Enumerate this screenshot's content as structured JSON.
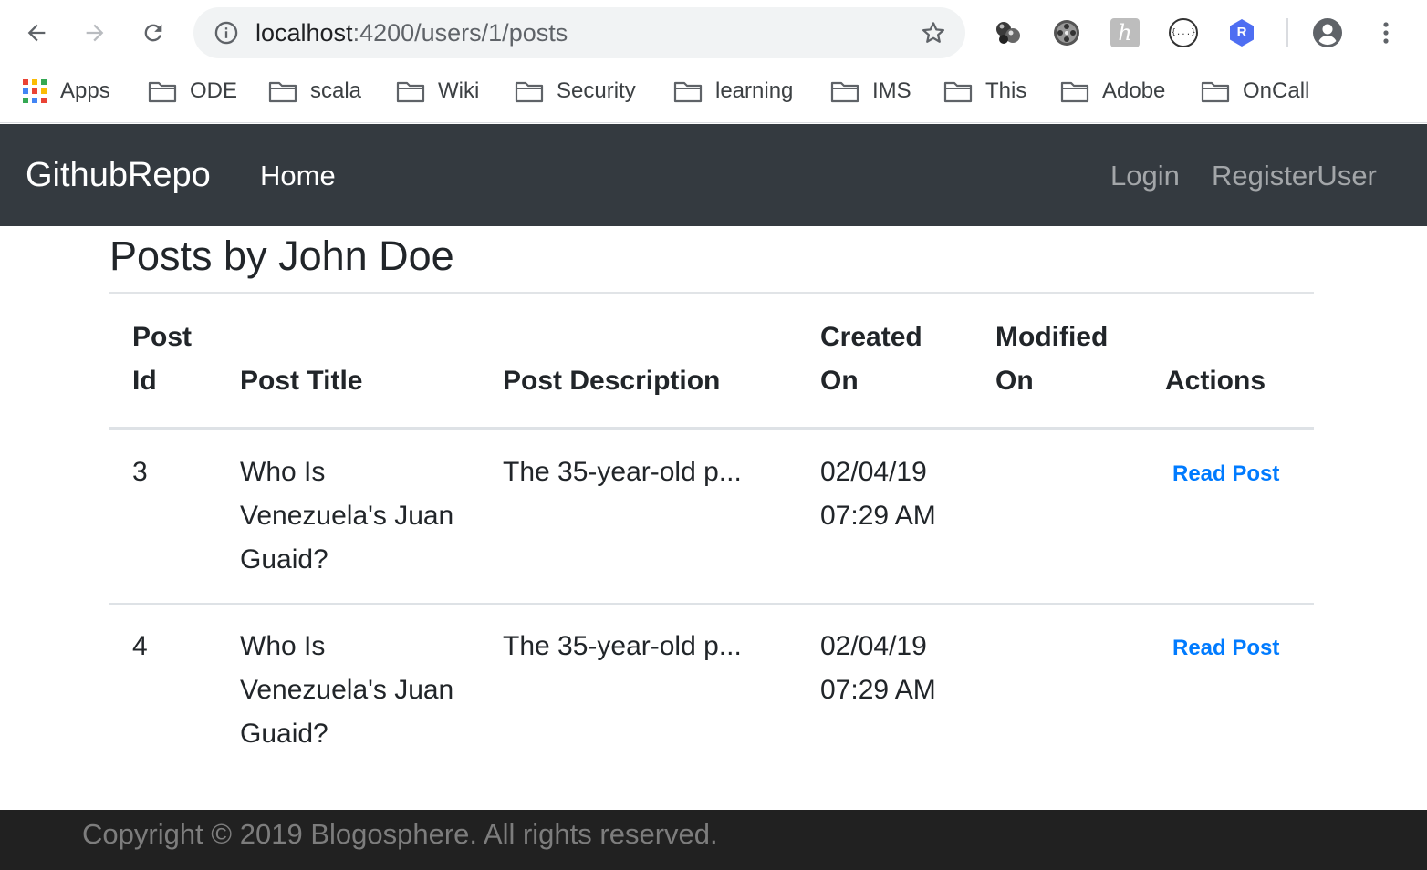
{
  "browser": {
    "url_host": "localhost",
    "url_rest": ":4200/users/1/posts",
    "bookmarks": [
      {
        "label": "Apps",
        "icon": "apps-grid-icon"
      },
      {
        "label": "ODE",
        "icon": "folder-icon"
      },
      {
        "label": "scala",
        "icon": "folder-icon"
      },
      {
        "label": "Wiki",
        "icon": "folder-icon"
      },
      {
        "label": "Security",
        "icon": "folder-icon"
      },
      {
        "label": "learning",
        "icon": "folder-icon"
      },
      {
        "label": "IMS",
        "icon": "folder-icon"
      },
      {
        "label": "This",
        "icon": "folder-icon"
      },
      {
        "label": "Adobe",
        "icon": "folder-icon"
      },
      {
        "label": "OnCall",
        "icon": "folder-icon"
      }
    ],
    "extensions": {
      "ext4_letter": "h",
      "ext5_glyph": "{...}",
      "ext6_letter": "R"
    }
  },
  "navbar": {
    "brand": "GithubRepo",
    "home": "Home",
    "login": "Login",
    "register": "RegisterUser"
  },
  "page": {
    "title": "Posts by John Doe"
  },
  "table": {
    "headers": [
      {
        "line1": "Post",
        "line2": "Id"
      },
      {
        "line1": "",
        "line2": "Post Title"
      },
      {
        "line1": "",
        "line2": "Post Description"
      },
      {
        "line1": "Created",
        "line2": "On"
      },
      {
        "line1": "Modified",
        "line2": "On"
      },
      {
        "line1": "",
        "line2": "Actions"
      }
    ],
    "rows": [
      {
        "id": "3",
        "title": "Who Is Venezuela's Juan Guaid?",
        "description": "The 35-year-old p...",
        "created_date": "02/04/19",
        "created_time": "07:29 AM",
        "modified": "",
        "action": "Read Post"
      },
      {
        "id": "4",
        "title": "Who Is Venezuela's Juan Guaid?",
        "description": "The 35-year-old p...",
        "created_date": "02/04/19",
        "created_time": "07:29 AM",
        "modified": "",
        "action": "Read Post"
      }
    ]
  },
  "footer": {
    "text": "Copyright © 2019 Blogosphere. All rights reserved."
  },
  "colors": {
    "navbar": "#343a40",
    "footer": "#212121",
    "link": "#007bff"
  }
}
